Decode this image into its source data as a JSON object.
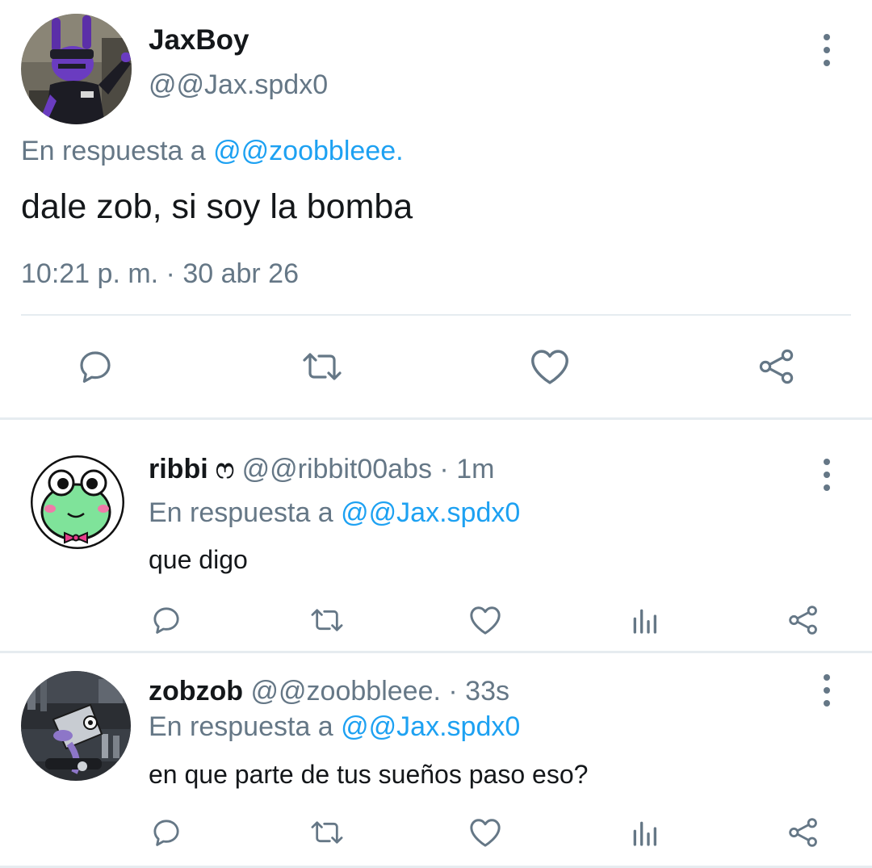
{
  "main_tweet": {
    "name": "JaxBoy",
    "handle": "@@Jax.spdx0",
    "reply_prefix": "En respuesta a",
    "reply_to": "@@zoobbleee.",
    "text": "dale zob, si soy la bomba",
    "timestamp": "10:21 p. m. · 30 abr 26",
    "actions": [
      "reply-icon",
      "retweet-icon",
      "like-icon",
      "share-icon"
    ]
  },
  "replies": [
    {
      "name": "ribbi ෆ",
      "handle": "@@ribbit00abs",
      "time": "· 1m",
      "reply_prefix": "En respuesta a",
      "reply_to": "@@Jax.spdx0",
      "text": "que digo",
      "actions": [
        "reply-icon",
        "retweet-icon",
        "like-icon",
        "analytics-icon",
        "share-icon"
      ]
    },
    {
      "name": "zobzob",
      "handle": "@@zoobbleee.",
      "time": "· 33s",
      "reply_prefix": "En respuesta a",
      "reply_to": "@@Jax.spdx0",
      "text": "en que parte de tus sueños paso eso?",
      "actions": [
        "reply-icon",
        "retweet-icon",
        "like-icon",
        "analytics-icon",
        "share-icon"
      ]
    }
  ],
  "colors": {
    "text_primary": "#14171a",
    "text_secondary": "#657786",
    "link": "#1da1f2",
    "divider": "#e6ecf0"
  }
}
